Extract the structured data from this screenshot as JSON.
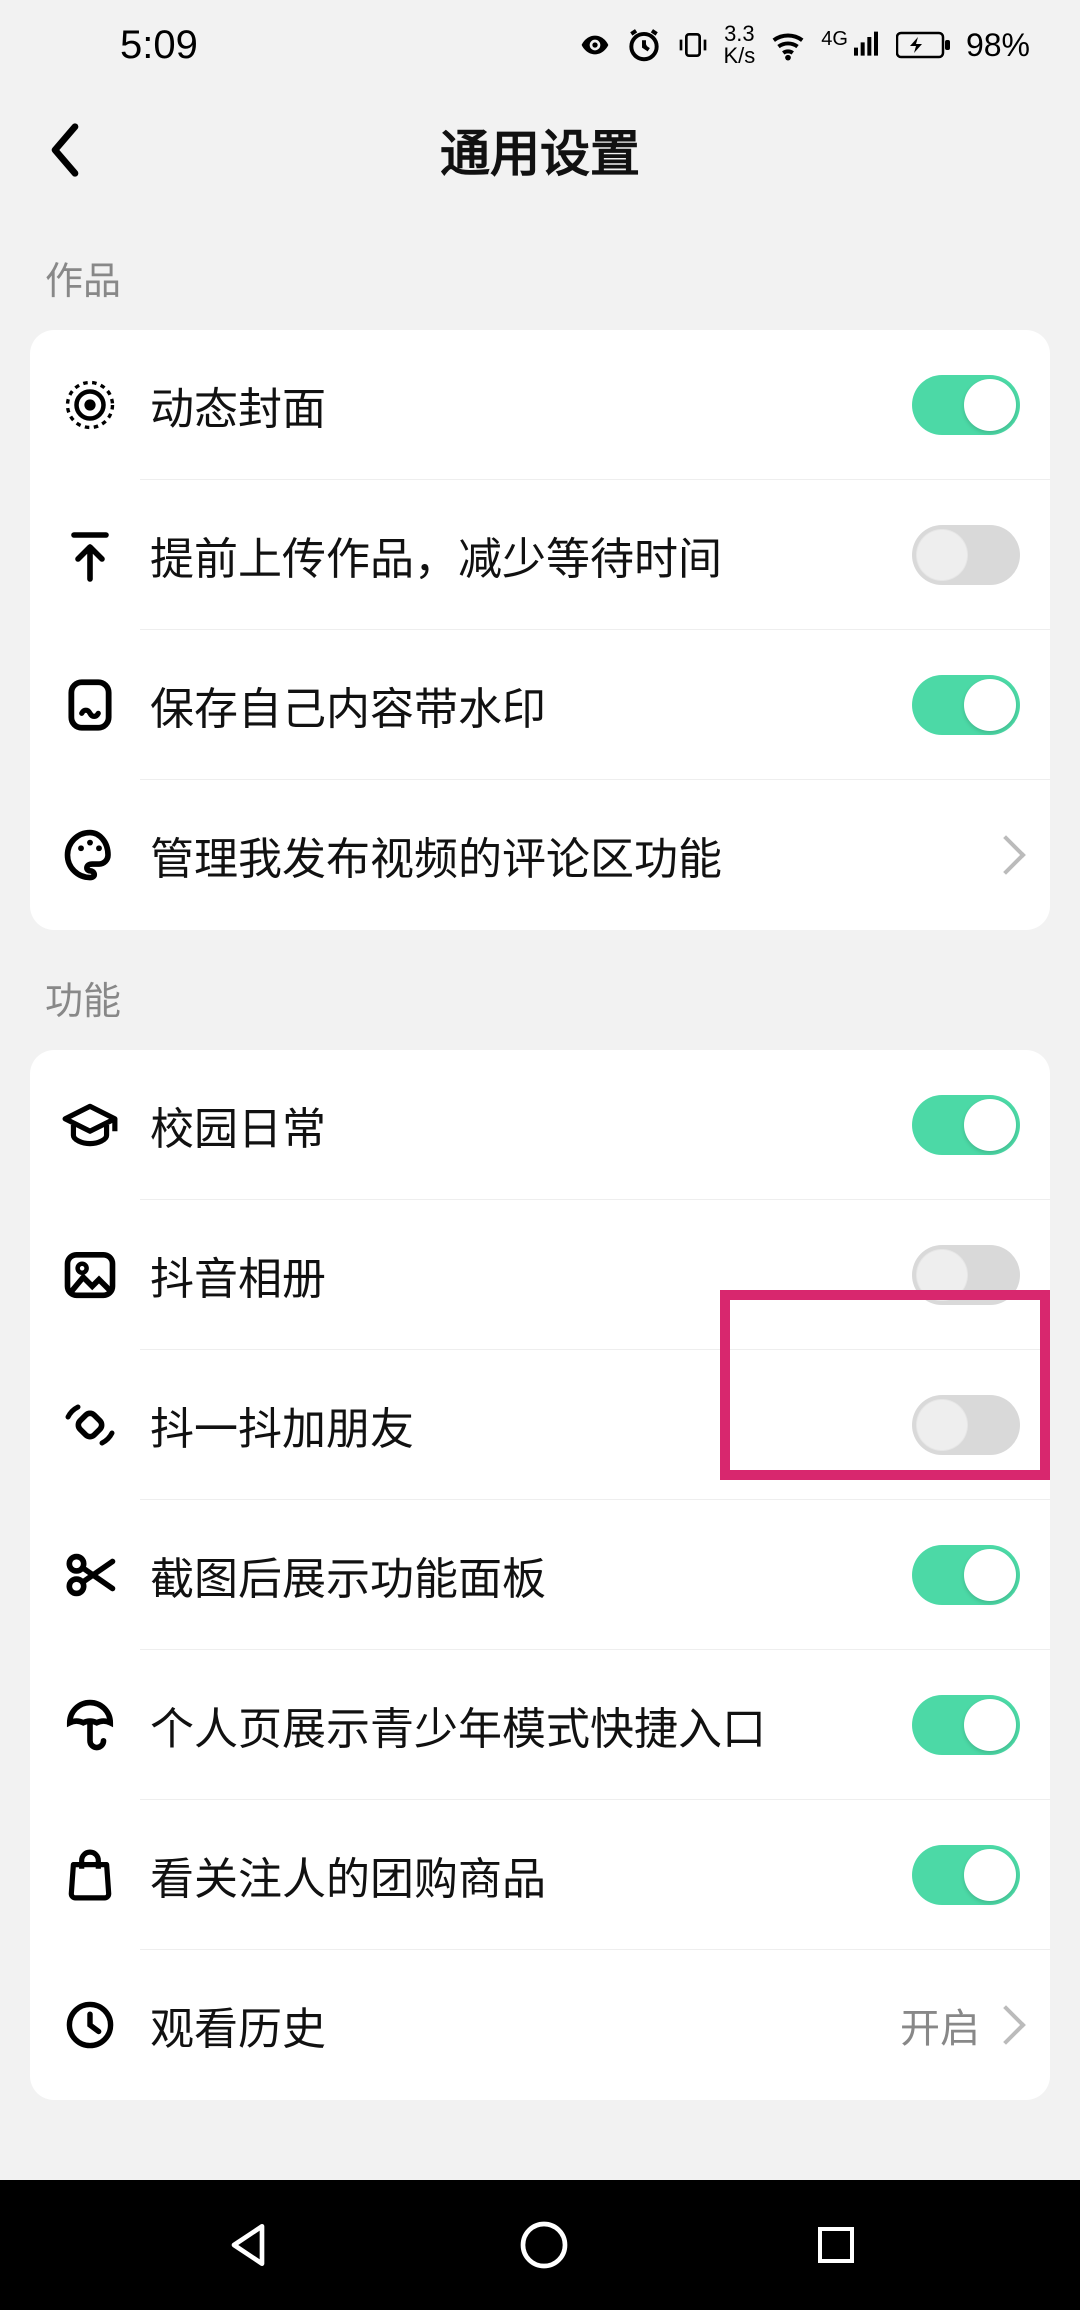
{
  "status": {
    "time": "5:09",
    "net_speed_top": "3.3",
    "net_speed_bottom": "K/s",
    "signal_prefix": "4G",
    "battery_pct": "98%"
  },
  "header": {
    "title": "通用设置"
  },
  "sections": [
    {
      "title": "作品",
      "rows": [
        {
          "icon": "target",
          "label": "动态封面",
          "type": "toggle",
          "on": true
        },
        {
          "icon": "upload-arrow",
          "label": "提前上传作品，减少等待时间",
          "type": "toggle",
          "on": false
        },
        {
          "icon": "rect-wave",
          "label": "保存自己内容带水印",
          "type": "toggle",
          "on": true
        },
        {
          "icon": "palette",
          "label": "管理我发布视频的评论区功能",
          "type": "nav"
        }
      ]
    },
    {
      "title": "功能",
      "rows": [
        {
          "icon": "grad-cap",
          "label": "校园日常",
          "type": "toggle",
          "on": true
        },
        {
          "icon": "image",
          "label": "抖音相册",
          "type": "toggle",
          "on": false,
          "highlight": true
        },
        {
          "icon": "shake-diamond",
          "label": "抖一抖加朋友",
          "type": "toggle",
          "on": false
        },
        {
          "icon": "scissors",
          "label": "截图后展示功能面板",
          "type": "toggle",
          "on": true
        },
        {
          "icon": "umbrella",
          "label": "个人页展示青少年模式快捷入口",
          "type": "toggle",
          "on": true
        },
        {
          "icon": "bag",
          "label": "看关注人的团购商品",
          "type": "toggle",
          "on": true
        },
        {
          "icon": "clock",
          "label": "观看历史",
          "type": "nav",
          "value": "开启"
        }
      ]
    }
  ]
}
